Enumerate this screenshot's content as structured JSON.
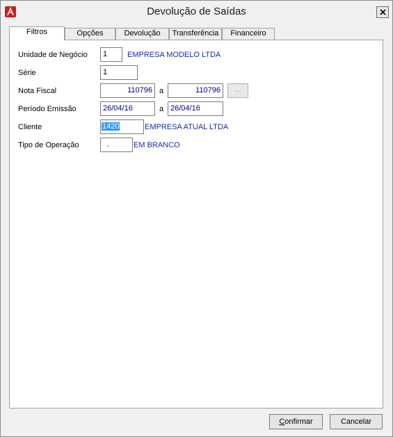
{
  "window": {
    "title": "Devolução de Saídas"
  },
  "tabs": [
    {
      "label": "Filtros"
    },
    {
      "label": "Opções"
    },
    {
      "label": "Devolução"
    },
    {
      "label": "Transferência"
    },
    {
      "label": "Financeiro"
    }
  ],
  "form": {
    "unidade": {
      "label": "Unidade de Negócio",
      "value": "1",
      "desc": "EMPRESA MODELO LTDA"
    },
    "serie": {
      "label": "Série",
      "value": "1"
    },
    "nota": {
      "label": "Nota Fiscal",
      "from": "110796",
      "sep": "a",
      "to": "110796",
      "button": "..."
    },
    "periodo": {
      "label": "Período Emissão",
      "from": "26/04/16",
      "sep": "a",
      "to": "26/04/16"
    },
    "cliente": {
      "label": "Cliente",
      "value": "1420",
      "desc": "EMPRESA ATUAL LTDA"
    },
    "tipo": {
      "label": "Tipo de Operação",
      "value": ".",
      "desc": "EM BRANCO"
    }
  },
  "buttons": {
    "confirm_mnemonic": "C",
    "confirm_rest": "onfirmar",
    "cancel": "Cancelar"
  },
  "colors": {
    "desc_text": "#1a2aa0",
    "selection": "#3399ff",
    "app_icon": "#c8201c"
  },
  "icons": {
    "app": "app-logo-icon",
    "close": "close-icon"
  }
}
